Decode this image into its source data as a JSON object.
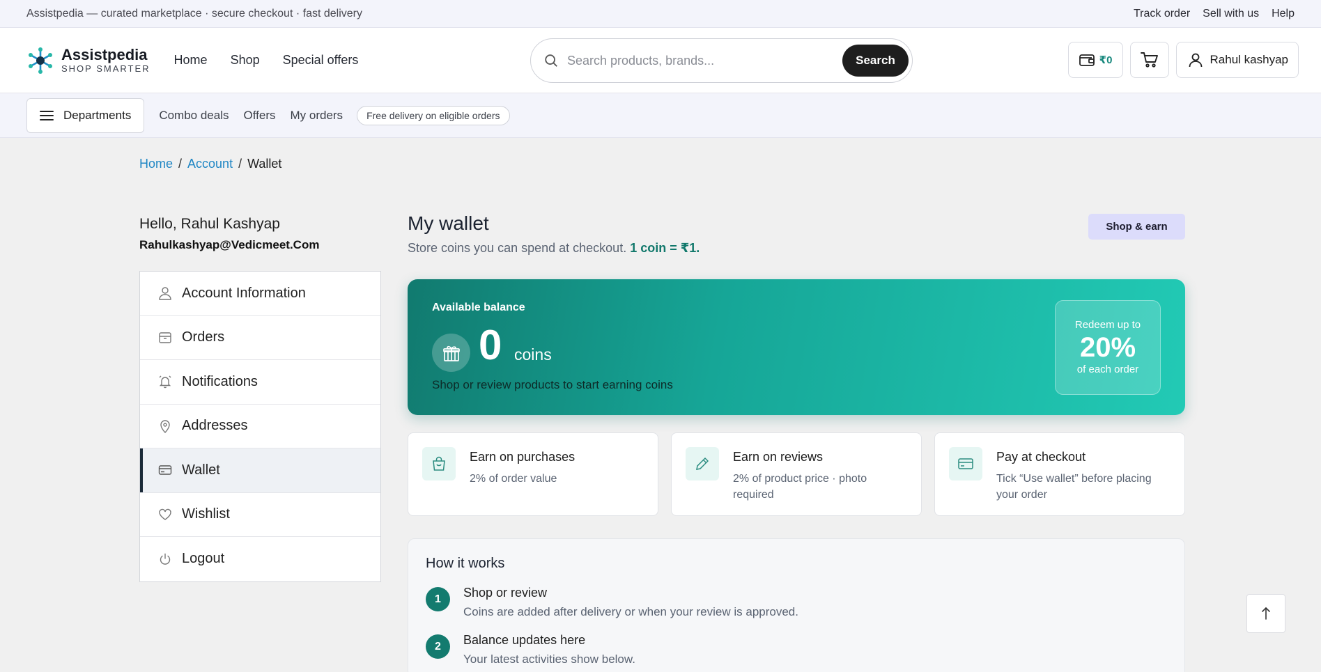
{
  "topstrip": {
    "tagline": "Assistpedia — curated marketplace · secure checkout · fast delivery",
    "links": [
      "Track order",
      "Sell with us",
      "Help"
    ]
  },
  "header": {
    "brand": "Assistpedia",
    "brand_tag": "SHOP SMARTER",
    "nav": [
      "Home",
      "Shop",
      "Special offers"
    ],
    "search_placeholder": "Search products, brands...",
    "search_button": "Search",
    "wallet_amount": "₹0",
    "user_name": "Rahul kashyap"
  },
  "subnav": {
    "departments": "Departments",
    "links": [
      "Combo deals",
      "Offers",
      "My orders"
    ],
    "pill": "Free delivery on eligible orders"
  },
  "breadcrumb": {
    "home": "Home",
    "account": "Account",
    "current": "Wallet",
    "sep": "/"
  },
  "sidebar": {
    "hello": "Hello, Rahul Kashyap",
    "email": "Rahulkashyap@Vedicmeet.Com",
    "items": [
      {
        "label": "Account Information",
        "icon": "user-icon"
      },
      {
        "label": "Orders",
        "icon": "box-icon"
      },
      {
        "label": "Notifications",
        "icon": "bell-icon"
      },
      {
        "label": "Addresses",
        "icon": "pin-icon"
      },
      {
        "label": "Wallet",
        "icon": "wallet-icon",
        "active": true
      },
      {
        "label": "Wishlist",
        "icon": "heart-icon"
      },
      {
        "label": "Logout",
        "icon": "power-icon"
      }
    ]
  },
  "main": {
    "title": "My wallet",
    "subtitle": "Store coins you can spend at checkout.",
    "subtitle_accent": "1 coin = ₹1.",
    "shop_earn": "Shop & earn",
    "balance": {
      "label": "Available balance",
      "value": "0",
      "unit": "coins",
      "hint": "Shop or review products to start earning coins",
      "redeem_top": "Redeem up to",
      "redeem_value": "20%",
      "redeem_bottom": "of each order"
    },
    "cards": [
      {
        "title": "Earn on purchases",
        "desc": "2% of order value",
        "icon": "bag-icon"
      },
      {
        "title": "Earn on reviews",
        "desc": "2% of product price · photo required",
        "icon": "pencil-icon"
      },
      {
        "title": "Pay at checkout",
        "desc": "Tick “Use wallet” before placing your order",
        "icon": "card-icon"
      }
    ],
    "how": {
      "title": "How it works",
      "steps": [
        {
          "n": "1",
          "title": "Shop or review",
          "desc": "Coins are added after delivery or when your review is approved."
        },
        {
          "n": "2",
          "title": "Balance updates here",
          "desc": "Your latest activities show below."
        }
      ]
    }
  },
  "colors": {
    "accent": "#137b6f",
    "link": "#1f86c4",
    "chip": "#dcdcfb"
  }
}
